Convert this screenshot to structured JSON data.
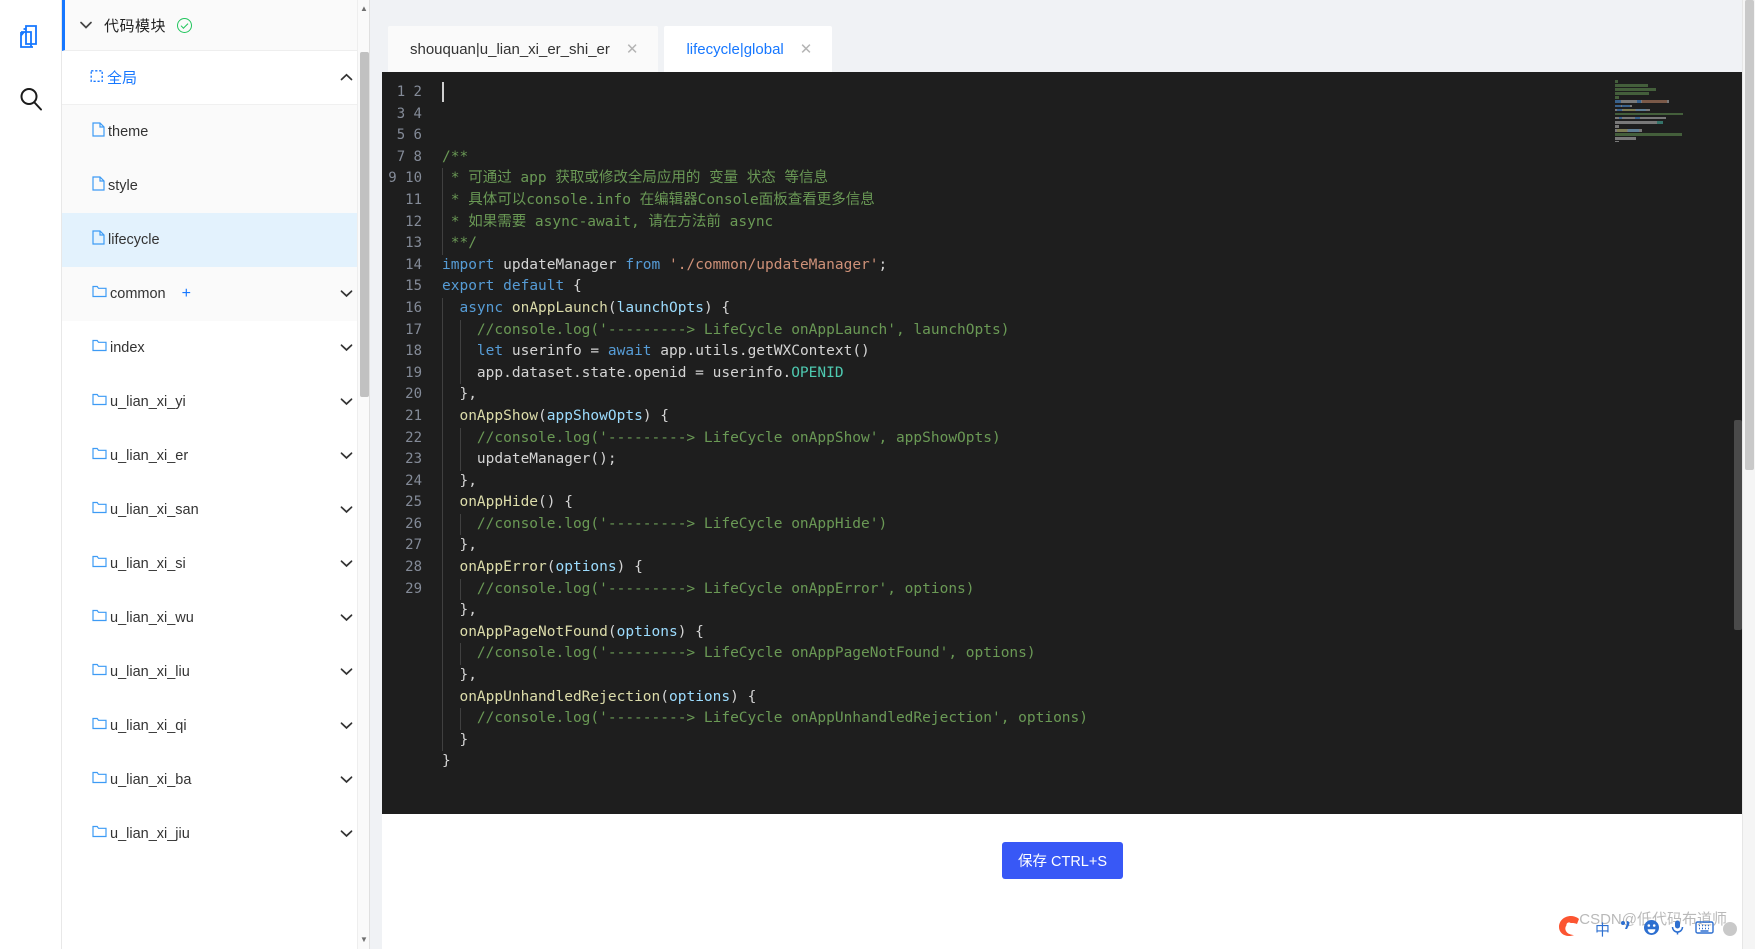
{
  "rail": {
    "items": [
      {
        "name": "copy-pages-icon",
        "label": "代码模块"
      },
      {
        "name": "search-icon",
        "label": "搜索"
      }
    ]
  },
  "explorer": {
    "header": {
      "caret": "⌄",
      "title": "代码模块",
      "status": "ok"
    },
    "group": {
      "label": "全局",
      "chevron": "⌃",
      "icon": "dashed-box-icon"
    },
    "files": [
      {
        "label": "theme",
        "icon": "file-icon",
        "selected": false
      },
      {
        "label": "style",
        "icon": "file-icon",
        "selected": false
      },
      {
        "label": "lifecycle",
        "icon": "file-icon",
        "selected": true
      }
    ],
    "folders": [
      {
        "label": "common",
        "icon": "folder-icon",
        "chevron": "⌄",
        "add": "+"
      },
      {
        "label": "index",
        "icon": "folder-icon",
        "chevron": "⌄"
      },
      {
        "label": "u_lian_xi_yi",
        "icon": "folder-icon",
        "chevron": "⌄"
      },
      {
        "label": "u_lian_xi_er",
        "icon": "folder-icon",
        "chevron": "⌄"
      },
      {
        "label": "u_lian_xi_san",
        "icon": "folder-icon",
        "chevron": "⌄"
      },
      {
        "label": "u_lian_xi_si",
        "icon": "folder-icon",
        "chevron": "⌄"
      },
      {
        "label": "u_lian_xi_wu",
        "icon": "folder-icon",
        "chevron": "⌄"
      },
      {
        "label": "u_lian_xi_liu",
        "icon": "folder-icon",
        "chevron": "⌄"
      },
      {
        "label": "u_lian_xi_qi",
        "icon": "folder-icon",
        "chevron": "⌄"
      },
      {
        "label": "u_lian_xi_ba",
        "icon": "folder-icon",
        "chevron": "⌄"
      },
      {
        "label": "u_lian_xi_jiu",
        "icon": "folder-icon",
        "chevron": "⌄"
      }
    ]
  },
  "tabs": [
    {
      "label": "shouquan|u_lian_xi_er_shi_er",
      "close": "✕",
      "active": false
    },
    {
      "label": "lifecycle|global",
      "close": "✕",
      "active": true
    }
  ],
  "editor": {
    "language": "javascript",
    "theme": "dark",
    "accent": "#1677ff",
    "background": "#1e1e1e",
    "line_count": 29,
    "lines": [
      {
        "n": 1,
        "tokens": [
          {
            "t": "/**",
            "c": "cmt"
          }
        ]
      },
      {
        "n": 2,
        "tokens": [
          {
            "t": " * 可通过 app 获取或修改全局应用的 变量 状态 等信息",
            "c": "cmt"
          }
        ]
      },
      {
        "n": 3,
        "tokens": [
          {
            "t": " * 具体可以console.info 在编辑器Console面板查看更多信息",
            "c": "cmt"
          }
        ]
      },
      {
        "n": 4,
        "tokens": [
          {
            "t": " * 如果需要 async-await, 请在方法前 async",
            "c": "cmt"
          }
        ]
      },
      {
        "n": 5,
        "tokens": [
          {
            "t": " **/",
            "c": "cmt"
          }
        ]
      },
      {
        "n": 6,
        "tokens": [
          {
            "t": "import",
            "c": "kw"
          },
          {
            "t": " updateManager ",
            "c": "plain"
          },
          {
            "t": "from",
            "c": "kw"
          },
          {
            "t": " ",
            "c": "plain"
          },
          {
            "t": "'./common/updateManager'",
            "c": "str"
          },
          {
            "t": ";",
            "c": "punc"
          }
        ]
      },
      {
        "n": 7,
        "tokens": [
          {
            "t": "export",
            "c": "kw"
          },
          {
            "t": " ",
            "c": "plain"
          },
          {
            "t": "default",
            "c": "kw"
          },
          {
            "t": " {",
            "c": "punc"
          }
        ]
      },
      {
        "n": 8,
        "tokens": [
          {
            "t": "  ",
            "c": "plain"
          },
          {
            "t": "async",
            "c": "kw"
          },
          {
            "t": " ",
            "c": "plain"
          },
          {
            "t": "onAppLaunch",
            "c": "fn"
          },
          {
            "t": "(",
            "c": "punc"
          },
          {
            "t": "launchOpts",
            "c": "par"
          },
          {
            "t": ") {",
            "c": "punc"
          }
        ]
      },
      {
        "n": 9,
        "tokens": [
          {
            "t": "    //console.log('---------> LifeCycle onAppLaunch', launchOpts)",
            "c": "cmt"
          }
        ]
      },
      {
        "n": 10,
        "tokens": [
          {
            "t": "    ",
            "c": "plain"
          },
          {
            "t": "let",
            "c": "kw"
          },
          {
            "t": " userinfo = ",
            "c": "plain"
          },
          {
            "t": "await",
            "c": "kw"
          },
          {
            "t": " app.utils.getWXContext()",
            "c": "plain"
          }
        ]
      },
      {
        "n": 11,
        "tokens": [
          {
            "t": "    app.dataset.state.openid = userinfo.",
            "c": "plain"
          },
          {
            "t": "OPENID",
            "c": "cons"
          }
        ]
      },
      {
        "n": 12,
        "tokens": [
          {
            "t": "  },",
            "c": "punc"
          }
        ]
      },
      {
        "n": 13,
        "tokens": [
          {
            "t": "  ",
            "c": "plain"
          },
          {
            "t": "onAppShow",
            "c": "fn"
          },
          {
            "t": "(",
            "c": "punc"
          },
          {
            "t": "appShowOpts",
            "c": "par"
          },
          {
            "t": ") {",
            "c": "punc"
          }
        ]
      },
      {
        "n": 14,
        "tokens": [
          {
            "t": "    //console.log('---------> LifeCycle onAppShow', appShowOpts)",
            "c": "cmt"
          }
        ]
      },
      {
        "n": 15,
        "tokens": [
          {
            "t": "    updateManager();",
            "c": "plain"
          }
        ]
      },
      {
        "n": 16,
        "tokens": [
          {
            "t": "  },",
            "c": "punc"
          }
        ]
      },
      {
        "n": 17,
        "tokens": [
          {
            "t": "  ",
            "c": "plain"
          },
          {
            "t": "onAppHide",
            "c": "fn"
          },
          {
            "t": "() {",
            "c": "punc"
          }
        ]
      },
      {
        "n": 18,
        "tokens": [
          {
            "t": "    //console.log('---------> LifeCycle onAppHide')",
            "c": "cmt"
          }
        ]
      },
      {
        "n": 19,
        "tokens": [
          {
            "t": "  },",
            "c": "punc"
          }
        ]
      },
      {
        "n": 20,
        "tokens": [
          {
            "t": "  ",
            "c": "plain"
          },
          {
            "t": "onAppError",
            "c": "fn"
          },
          {
            "t": "(",
            "c": "punc"
          },
          {
            "t": "options",
            "c": "par"
          },
          {
            "t": ") {",
            "c": "punc"
          }
        ]
      },
      {
        "n": 21,
        "tokens": [
          {
            "t": "    //console.log('---------> LifeCycle onAppError', options)",
            "c": "cmt"
          }
        ]
      },
      {
        "n": 22,
        "tokens": [
          {
            "t": "  },",
            "c": "punc"
          }
        ]
      },
      {
        "n": 23,
        "tokens": [
          {
            "t": "  ",
            "c": "plain"
          },
          {
            "t": "onAppPageNotFound",
            "c": "fn"
          },
          {
            "t": "(",
            "c": "punc"
          },
          {
            "t": "options",
            "c": "par"
          },
          {
            "t": ") {",
            "c": "punc"
          }
        ]
      },
      {
        "n": 24,
        "tokens": [
          {
            "t": "    //console.log('---------> LifeCycle onAppPageNotFound', options)",
            "c": "cmt"
          }
        ]
      },
      {
        "n": 25,
        "tokens": [
          {
            "t": "  },",
            "c": "punc"
          }
        ]
      },
      {
        "n": 26,
        "tokens": [
          {
            "t": "  ",
            "c": "plain"
          },
          {
            "t": "onAppUnhandledRejection",
            "c": "fn"
          },
          {
            "t": "(",
            "c": "punc"
          },
          {
            "t": "options",
            "c": "par"
          },
          {
            "t": ") {",
            "c": "punc"
          }
        ]
      },
      {
        "n": 27,
        "tokens": [
          {
            "t": "    //console.log('---------> LifeCycle onAppUnhandledRejection', options)",
            "c": "cmt"
          }
        ]
      },
      {
        "n": 28,
        "tokens": [
          {
            "t": "  }",
            "c": "punc"
          }
        ]
      },
      {
        "n": 29,
        "tokens": [
          {
            "t": "}",
            "c": "punc"
          }
        ]
      }
    ]
  },
  "footer": {
    "save_label": "保存 CTRL+S",
    "save_color": "#3858f6"
  },
  "watermark": {
    "brand": "CSDN",
    "text": "@低代码布道师",
    "ime": [
      "中",
      "✎",
      "☺",
      "🎙",
      "⌨"
    ]
  }
}
